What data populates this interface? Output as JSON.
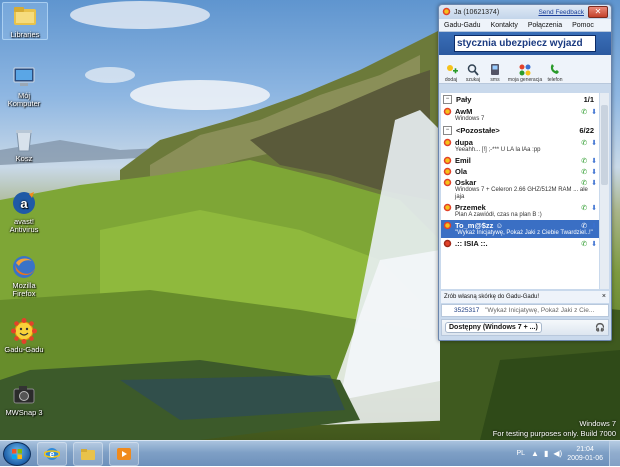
{
  "desktop": {
    "icons": [
      {
        "label": "Libraries",
        "icon": "folder-icon"
      },
      {
        "label": "Mój Komputer",
        "icon": "computer-icon"
      },
      {
        "label": "Kosz",
        "icon": "recycle-bin-icon"
      },
      {
        "label": "avast! Antivirus",
        "icon": "avast-icon"
      },
      {
        "label": "Mozilla Firefox",
        "icon": "firefox-icon"
      },
      {
        "label": "Gadu-Gadu",
        "icon": "gadu-gadu-icon"
      },
      {
        "label": "MWSnap 3",
        "icon": "camera-icon"
      }
    ]
  },
  "gadu": {
    "title": "Ja (10621374)",
    "feedback": "Send Feedback",
    "menu": [
      "Gadu-Gadu",
      "Kontakty",
      "Połączenia",
      "Pomoc"
    ],
    "status_text": "stycznia ubezpiecz wyjazd",
    "toolbar": [
      {
        "label": "dodaj",
        "icon": "add-contact-icon"
      },
      {
        "label": "szukaj",
        "icon": "search-icon"
      },
      {
        "label": "sms",
        "icon": "sms-icon"
      },
      {
        "label": "moja generacja",
        "icon": "community-icon"
      },
      {
        "label": "telefon",
        "icon": "phone-icon"
      }
    ],
    "groups": [
      {
        "name": "Pały",
        "count": "1/1",
        "contacts": [
          {
            "name": "AwM",
            "desc": "Windows 7"
          }
        ]
      },
      {
        "name": "<Pozostałe>",
        "count": "6/22",
        "contacts": [
          {
            "name": "dupa",
            "desc": "Yeeahh... [!] ;-*** U LA la lAa :pp"
          },
          {
            "name": "Emil",
            "desc": ""
          },
          {
            "name": "Ola",
            "desc": ""
          },
          {
            "name": "Oskar",
            "desc": "Windows 7 + Celeron 2.66 GHZ/512M RAM ... ale jaja"
          },
          {
            "name": "Przemek",
            "desc": "Plan A zawiódł, czas na plan B :)"
          },
          {
            "name": "To_m@$zz ☺",
            "desc": "\"Wykaż Inicjatywę, Pokaż Jaki z Ciebie Twardziel..!\"",
            "selected": true
          },
          {
            "name": ".:: ISIA ::.",
            "desc": ""
          }
        ]
      }
    ],
    "ad_text": "Zrób własną skórkę do Gadu-Gadu!",
    "last_number": "3525317",
    "last_desc": "\"Wykaż Inicjatywę, Pokaż Jaki z Cie...",
    "status_label": "Dostępny (Windows 7 + ...)"
  },
  "watermark": {
    "line1": "Windows 7",
    "line2": "For testing purposes only. Build 7000"
  },
  "taskbar": {
    "lang": "PL",
    "time": "21:04",
    "date": "2009-01-06",
    "pinned": [
      "internet-explorer-icon",
      "explorer-folder-icon",
      "media-player-icon"
    ]
  },
  "colors": {
    "accent": "#3a6fc4",
    "status_bar": "#2c5aa0",
    "taskbar": "#7fa0c6"
  }
}
